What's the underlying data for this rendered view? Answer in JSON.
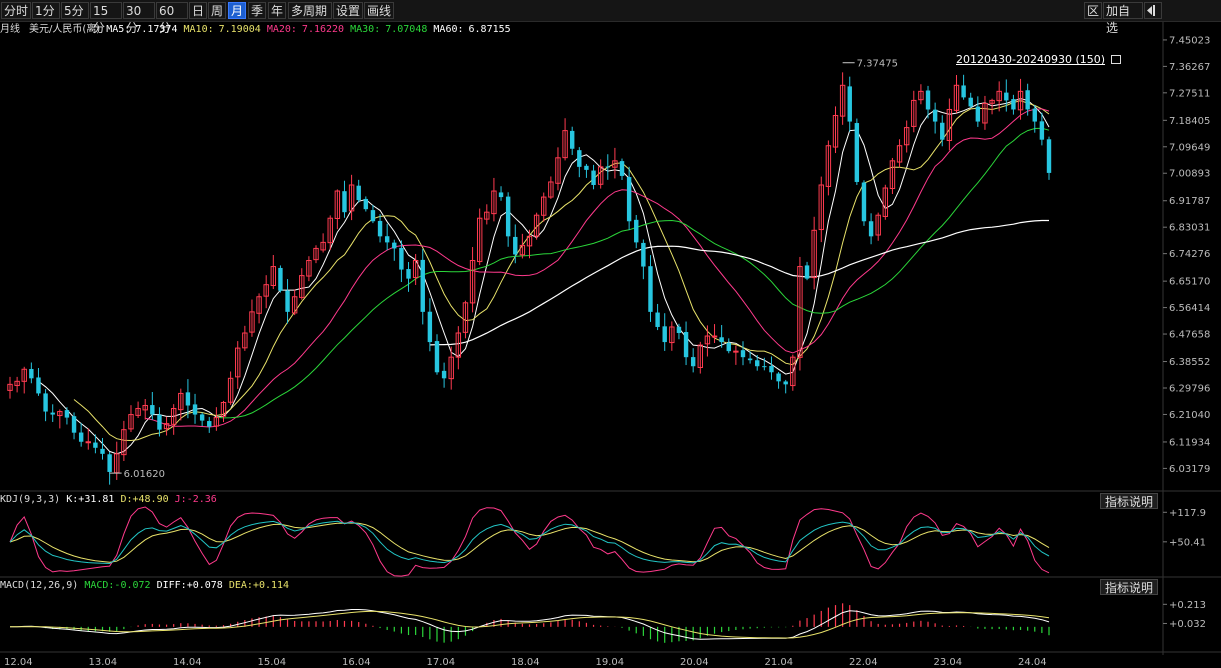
{
  "toolbar": {
    "periods": [
      "分时",
      "1分",
      "5分",
      "15分",
      "30分",
      "60分",
      "日",
      "周",
      "月",
      "季",
      "年",
      "多周期",
      "设置",
      "画线"
    ],
    "active": "月",
    "right": {
      "zone": "区",
      "add_watch": "加自选",
      "exit_icon": "exit-icon"
    }
  },
  "header": {
    "chart_type": "月线",
    "symbol": "美元/人民币(离)",
    "ma5_label": "MA5:",
    "ma5_value": "7.17374",
    "ma10_label": "MA10:",
    "ma10_value": "7.19004",
    "ma20_label": "MA20:",
    "ma20_value": "7.16220",
    "ma30_label": "MA30:",
    "ma30_value": "7.07048",
    "ma60_label": "MA60:",
    "ma60_value": "6.87155"
  },
  "range_label": "20120430-20240930 (150)",
  "annotations": {
    "high": "7.37475",
    "low": "6.01620"
  },
  "kdj": {
    "label": "KDJ(9,3,3)",
    "k_label": "K:",
    "k": "+31.81",
    "d_label": "D:",
    "d": "+48.90",
    "j_label": "J:",
    "j": "-2.36",
    "explain": "指标说明"
  },
  "macd": {
    "label": "MACD(12,26,9)",
    "macd_label": "MACD:",
    "macd": "-0.072",
    "diff_label": "DIFF:",
    "diff": "+0.078",
    "dea_label": "DEA:",
    "dea": "+0.114",
    "explain": "指标说明"
  },
  "colors": {
    "up": "#ff3b50",
    "down": "#27c6e0",
    "ma5": "#ffffff",
    "ma10": "#e8e26a",
    "ma20": "#ff3a8c",
    "ma30": "#2bd63a",
    "ma60": "#ffffff",
    "k": "#ffffff",
    "d": "#e8e26a",
    "j": "#ff3a8c",
    "kdj_line": "#22c5c5"
  },
  "chart_data": {
    "type": "candlestick",
    "price_axis": [
      "7.45023",
      "7.36267",
      "7.27511",
      "7.18405",
      "7.09649",
      "7.00893",
      "6.91787",
      "6.83031",
      "6.74276",
      "6.65170",
      "6.56414",
      "6.47658",
      "6.38552",
      "6.29796",
      "6.21040",
      "6.11934",
      "6.03179"
    ],
    "price_range": [
      6.0,
      7.45
    ],
    "kdj_axis": [
      "+117.9",
      "+50.41"
    ],
    "macd_axis": [
      "+0.213",
      "+0.032"
    ],
    "x_labels": [
      "12.04",
      "13.04",
      "14.04",
      "15.04",
      "16.04",
      "17.04",
      "18.04",
      "19.04",
      "20.04",
      "21.04",
      "22.04",
      "23.04",
      "24.04"
    ],
    "close_path": [
      6.31,
      6.32,
      6.36,
      6.33,
      6.28,
      6.22,
      6.21,
      6.22,
      6.2,
      6.15,
      6.12,
      6.12,
      6.1,
      6.08,
      6.02,
      6.08,
      6.16,
      6.21,
      6.23,
      6.24,
      6.21,
      6.16,
      6.18,
      6.23,
      6.28,
      6.24,
      6.21,
      6.19,
      6.17,
      6.2,
      6.25,
      6.33,
      6.43,
      6.48,
      6.55,
      6.6,
      6.64,
      6.7,
      6.62,
      6.55,
      6.6,
      6.67,
      6.72,
      6.76,
      6.78,
      6.86,
      6.95,
      6.88,
      6.97,
      6.92,
      6.89,
      6.85,
      6.8,
      6.78,
      6.76,
      6.69,
      6.66,
      6.72,
      6.55,
      6.45,
      6.35,
      6.33,
      6.4,
      6.48,
      6.58,
      6.72,
      6.86,
      6.88,
      6.95,
      6.93,
      6.8,
      6.74,
      6.77,
      6.8,
      6.87,
      6.93,
      6.98,
      7.06,
      7.15,
      7.09,
      7.03,
      7.02,
      6.97,
      7.03,
      7.03,
      7.05,
      7.0,
      6.85,
      6.78,
      6.7,
      6.55,
      6.5,
      6.45,
      6.5,
      6.48,
      6.4,
      6.37,
      6.44,
      6.47,
      6.47,
      6.45,
      6.42,
      6.42,
      6.4,
      6.39,
      6.37,
      6.37,
      6.35,
      6.32,
      6.31,
      6.4,
      6.7,
      6.66,
      6.82,
      6.97,
      7.1,
      7.2,
      7.3,
      7.18,
      6.98,
      6.85,
      6.8,
      6.87,
      6.96,
      7.05,
      7.1,
      7.16,
      7.25,
      7.28,
      7.22,
      7.18,
      7.12,
      7.22,
      7.3,
      7.26,
      7.23,
      7.18,
      7.24,
      7.25,
      7.28,
      7.25,
      7.22,
      7.28,
      7.22,
      7.18,
      7.12,
      7.01
    ]
  }
}
